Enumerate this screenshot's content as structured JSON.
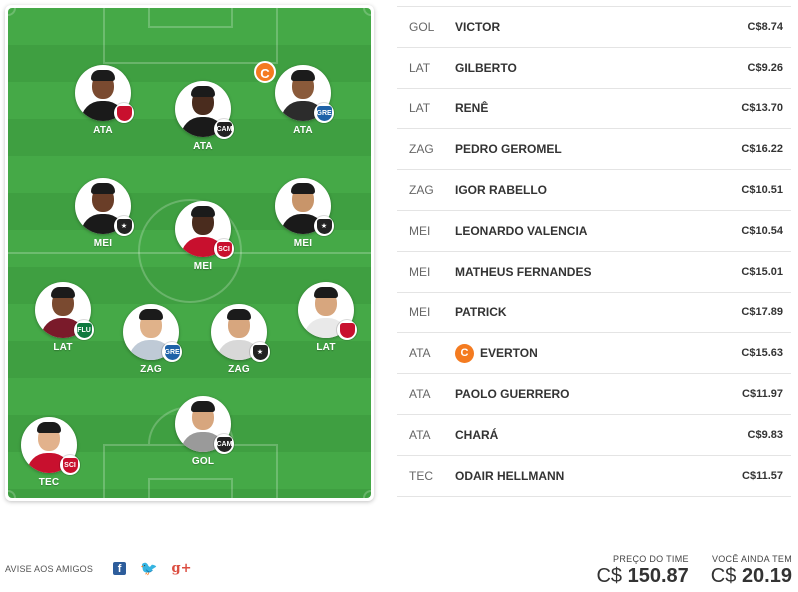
{
  "field": {
    "players": [
      {
        "pos": "ATA",
        "skin": "#7a4a30",
        "shirt": "#1a1a1a",
        "shield_bg": "#c8102e",
        "shield_text": "",
        "captain": false
      },
      {
        "pos": "ATA",
        "skin": "#4a2c1e",
        "shirt": "#1a1a1a",
        "shield_bg": "#222222",
        "shield_text": "CAM",
        "captain": false
      },
      {
        "pos": "ATA",
        "skin": "#8a5a3a",
        "shirt": "#2c2c2c",
        "shield_bg": "#1f62a8",
        "shield_text": "GRE",
        "captain": true,
        "captain_label": "C"
      },
      {
        "pos": "MEI",
        "skin": "#6a3e28",
        "shirt": "#1a1a1a",
        "shield_bg": "#222222",
        "shield_text": "★",
        "captain": false
      },
      {
        "pos": "MEI",
        "skin": "#4a2c1e",
        "shirt": "#c8102e",
        "shield_bg": "#c8102e",
        "shield_text": "SCI",
        "captain": false
      },
      {
        "pos": "MEI",
        "skin": "#c8956a",
        "shirt": "#1a1a1a",
        "shield_bg": "#222222",
        "shield_text": "★",
        "captain": false
      },
      {
        "pos": "LAT",
        "skin": "#7a4a30",
        "shirt": "#7a1a2a",
        "shield_bg": "#0e7a3e",
        "shield_text": "FLU",
        "captain": false
      },
      {
        "pos": "ZAG",
        "skin": "#e0b28a",
        "shirt": "#bfcad6",
        "shield_bg": "#1f62a8",
        "shield_text": "GRE",
        "captain": false
      },
      {
        "pos": "ZAG",
        "skin": "#d7a67e",
        "shirt": "#d8d8d8",
        "shield_bg": "#222222",
        "shield_text": "★",
        "captain": false
      },
      {
        "pos": "LAT",
        "skin": "#d7a67e",
        "shirt": "#e9e9e9",
        "shield_bg": "#c8102e",
        "shield_text": "",
        "captain": false
      },
      {
        "pos": "GOL",
        "skin": "#d7a67e",
        "shirt": "#9a9a9a",
        "shield_bg": "#222222",
        "shield_text": "CAM",
        "captain": false
      },
      {
        "pos": "TEC",
        "skin": "#e2b28c",
        "shirt": "#c8102e",
        "shield_bg": "#c8102e",
        "shield_text": "SCI",
        "captain": false
      }
    ]
  },
  "lineup": [
    {
      "pos": "GOL",
      "name": "VICTOR",
      "price": "C$8.74",
      "captain": false
    },
    {
      "pos": "LAT",
      "name": "GILBERTO",
      "price": "C$9.26",
      "captain": false
    },
    {
      "pos": "LAT",
      "name": "RENÊ",
      "price": "C$13.70",
      "captain": false
    },
    {
      "pos": "ZAG",
      "name": "PEDRO GEROMEL",
      "price": "C$16.22",
      "captain": false
    },
    {
      "pos": "ZAG",
      "name": "IGOR RABELLO",
      "price": "C$10.51",
      "captain": false
    },
    {
      "pos": "MEI",
      "name": "LEONARDO VALENCIA",
      "price": "C$10.54",
      "captain": false
    },
    {
      "pos": "MEI",
      "name": "MATHEUS FERNANDES",
      "price": "C$15.01",
      "captain": false
    },
    {
      "pos": "MEI",
      "name": "PATRICK",
      "price": "C$17.89",
      "captain": false
    },
    {
      "pos": "ATA",
      "name": "EVERTON",
      "price": "C$15.63",
      "captain": true,
      "captain_label": "C"
    },
    {
      "pos": "ATA",
      "name": "PAOLO GUERRERO",
      "price": "C$11.97",
      "captain": false
    },
    {
      "pos": "ATA",
      "name": "CHARÁ",
      "price": "C$9.83",
      "captain": false
    },
    {
      "pos": "TEC",
      "name": "ODAIR HELLMANN",
      "price": "C$11.57",
      "captain": false
    }
  ],
  "share": {
    "label": "AVISE AOS AMIGOS",
    "facebook_glyph": "f",
    "twitter_glyph": "🐦",
    "gplus_glyph": "g+"
  },
  "totals": {
    "team_price_label": "PREÇO DO TIME",
    "team_price_currency": "C$",
    "team_price_value": "150.87",
    "remaining_label": "VOCÊ AINDA TEM",
    "remaining_currency": "C$",
    "remaining_value": "20.19"
  }
}
